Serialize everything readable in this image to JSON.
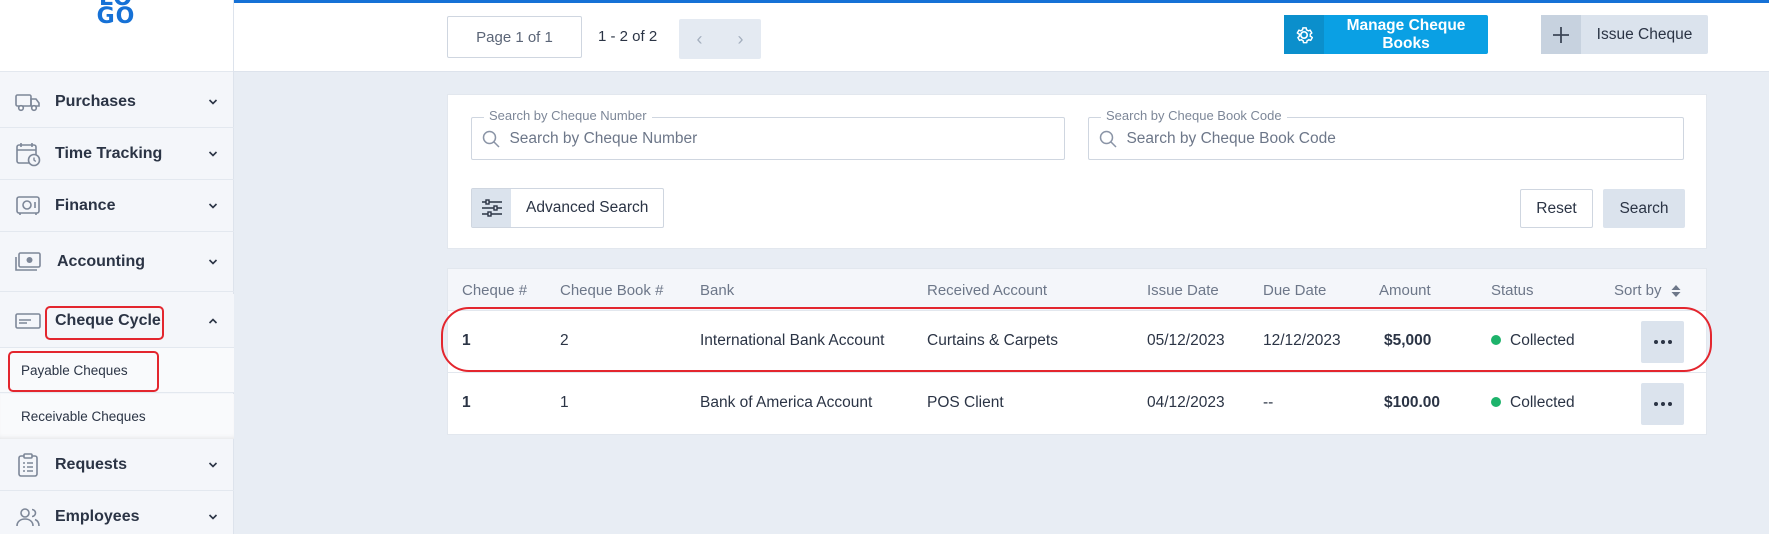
{
  "brand": {
    "logo_text": "LO GO"
  },
  "sidebar": {
    "items": [
      {
        "label": "Purchases",
        "icon": "truck-icon"
      },
      {
        "label": "Time Tracking",
        "icon": "calendar-clock-icon"
      },
      {
        "label": "Finance",
        "icon": "safe-icon"
      },
      {
        "label": "Accounting",
        "icon": "cash-icon"
      },
      {
        "label": "Cheque Cycle",
        "icon": "cheque-icon",
        "expanded": true
      },
      {
        "label": "Requests",
        "icon": "clipboard-icon"
      },
      {
        "label": "Employees",
        "icon": "users-icon"
      }
    ],
    "subitems": [
      {
        "label": "Payable Cheques",
        "active": true
      },
      {
        "label": "Receivable Cheques"
      }
    ]
  },
  "toolbar": {
    "pager_label": "Page 1 of 1",
    "pager_count": "1 - 2 of 2",
    "prev_glyph": "‹",
    "next_glyph": "›",
    "manage_label": "Manage Cheque Books",
    "issue_label": "Issue Cheque"
  },
  "search": {
    "cheque_number_label": "Search by Cheque Number",
    "cheque_number_placeholder": "Search by Cheque Number",
    "cheque_book_label": "Search by Cheque Book Code",
    "cheque_book_placeholder": "Search by Cheque Book Code",
    "advanced_label": "Advanced Search",
    "reset_label": "Reset",
    "search_label": "Search"
  },
  "table": {
    "headers": {
      "cheque": "Cheque #",
      "book": "Cheque Book #",
      "bank": "Bank",
      "account": "Received Account",
      "issue": "Issue Date",
      "due": "Due Date",
      "amount": "Amount",
      "status": "Status",
      "sort": "Sort by"
    },
    "rows": [
      {
        "cheque": "1",
        "book": "2",
        "bank": "International Bank Account",
        "account": "Curtains & Carpets",
        "issue": "05/12/2023",
        "due": "12/12/2023",
        "amount": "$5,000",
        "status": "Collected"
      },
      {
        "cheque": "1",
        "book": "1",
        "bank": "Bank of America Account",
        "account": "POS Client",
        "issue": "04/12/2023",
        "due": "--",
        "amount": "$100.00",
        "status": "Collected"
      }
    ]
  },
  "colors": {
    "accent": "#1671d6",
    "manage_button": "#0aa0e4",
    "status_collected": "#1db36b",
    "highlight": "#e3262e"
  }
}
